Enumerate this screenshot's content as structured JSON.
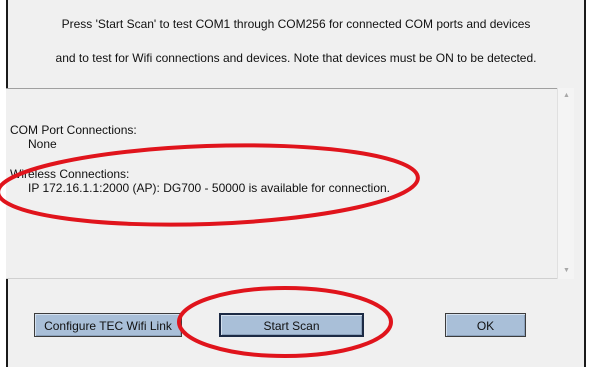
{
  "dialog": {
    "instruction_line1": "Press 'Start Scan' to test COM1 through COM256 for connected COM ports and devices",
    "instruction_line2": "and to test for Wifi connections and devices.  Note that devices must be ON to be detected."
  },
  "results": {
    "com_heading": "COM Port Connections:",
    "com_value": "None",
    "wireless_heading": "Wireless Connections:",
    "wireless_value": "IP 172.16.1.1:2000 (AP):  DG700 - 50000 is available for connection."
  },
  "buttons": {
    "configure_label": "Configure TEC Wifi Link",
    "start_scan_label": "Start Scan",
    "ok_label": "OK"
  },
  "icons": {
    "scroll_up": "scroll-up-arrow-icon",
    "scroll_down": "scroll-down-arrow-icon"
  },
  "colors": {
    "dialog_background": "#f0f0f0",
    "button_face": "#a9bfd8",
    "annotation_red": "#e0141c"
  }
}
